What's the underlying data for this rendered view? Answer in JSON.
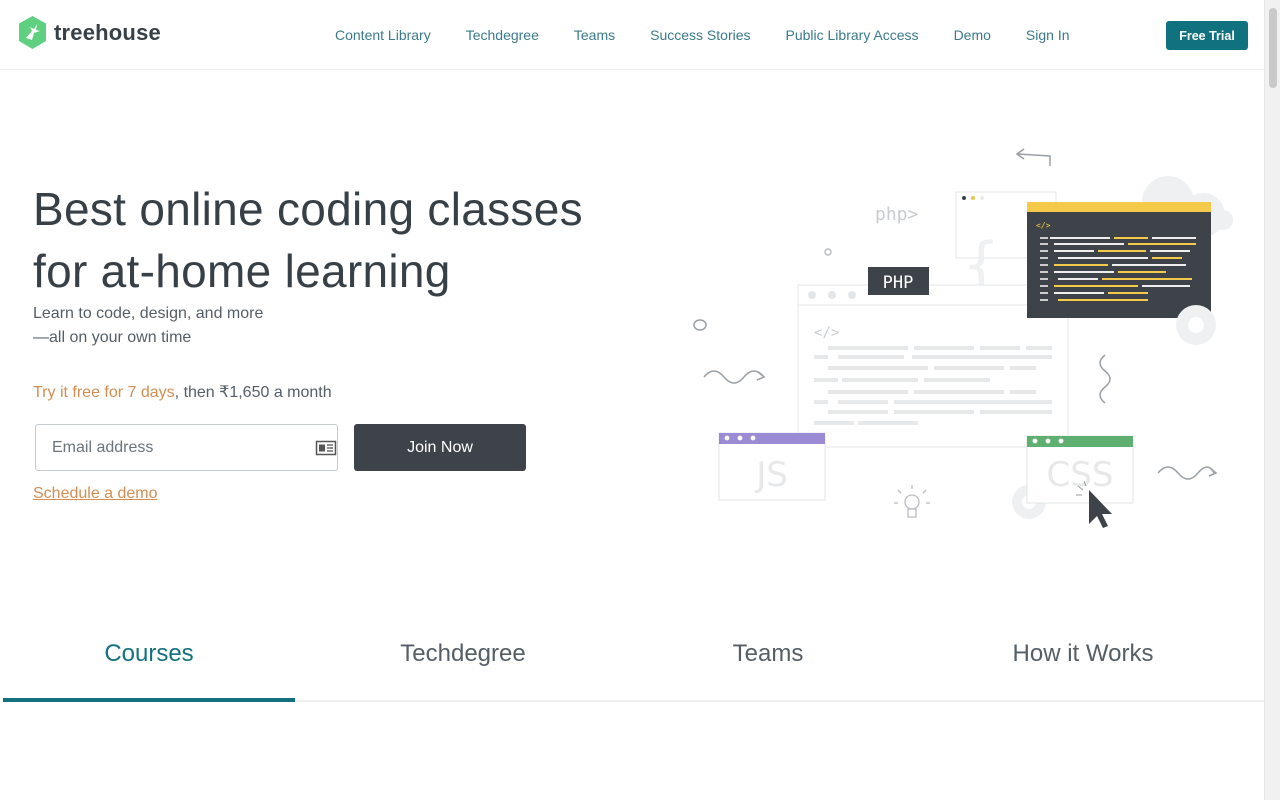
{
  "brand": {
    "name": "treehouse",
    "color": "#5fcf80"
  },
  "nav": {
    "items": [
      {
        "label": "Content Library"
      },
      {
        "label": "Techdegree"
      },
      {
        "label": "Teams"
      },
      {
        "label": "Success Stories"
      },
      {
        "label": "Public Library Access"
      },
      {
        "label": "Demo"
      },
      {
        "label": "Sign In"
      }
    ],
    "cta_label": "Free Trial"
  },
  "hero": {
    "title_line1": "Best online coding classes",
    "title_line2": "for at-home learning",
    "subtitle_line1": "Learn to code, design, and more",
    "subtitle_line2": "—all on your own time",
    "trial_accent": "Try it free for 7 days",
    "trial_rest": ", then ₹1,650 a month",
    "email_placeholder": "Email address",
    "join_label": "Join Now",
    "demo_link": "Schedule a demo"
  },
  "illustration": {
    "php_badge": "PHP",
    "php_script": "php>",
    "code_tag": "</>",
    "js_label": "JS",
    "css_label": "CSS"
  },
  "tabs": [
    {
      "label": "Courses",
      "active": true
    },
    {
      "label": "Techdegree",
      "active": false
    },
    {
      "label": "Teams",
      "active": false
    },
    {
      "label": "How it Works",
      "active": false
    }
  ],
  "colors": {
    "accent": "#13717f",
    "orange": "#d38d51",
    "dark": "#3d4348"
  }
}
